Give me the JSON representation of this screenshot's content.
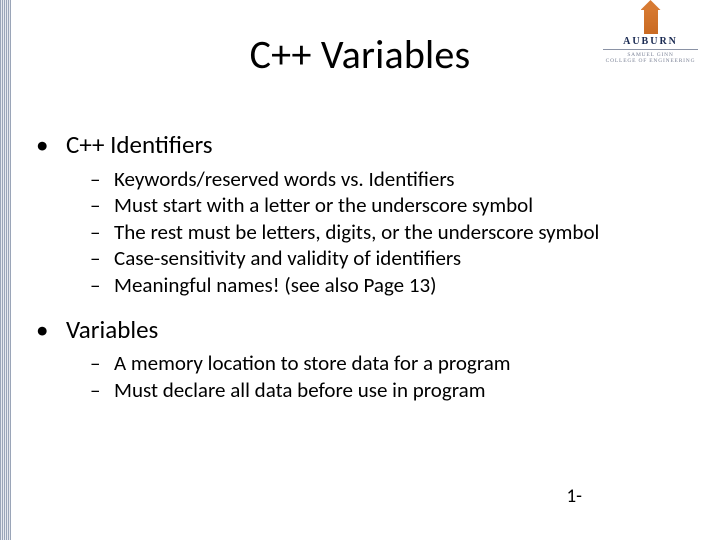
{
  "title": "C++ Variables",
  "logo": {
    "word": "AUBURN",
    "sub_line1": "SAMUEL GINN",
    "sub_line2": "COLLEGE OF ENGINEERING"
  },
  "sections": [
    {
      "heading": "C++ Identifiers",
      "items": [
        "Keywords/reserved words vs. Identifiers",
        "Must start with a letter or the underscore symbol",
        "The rest must be letters, digits, or the underscore symbol",
        "Case-sensitivity and validity of identifiers",
        "Meaningful names! (see also Page 13)"
      ]
    },
    {
      "heading": "Variables",
      "items": [
        "A memory location to store data for a program",
        "Must declare all data before use in program"
      ]
    }
  ],
  "pager": "1-"
}
